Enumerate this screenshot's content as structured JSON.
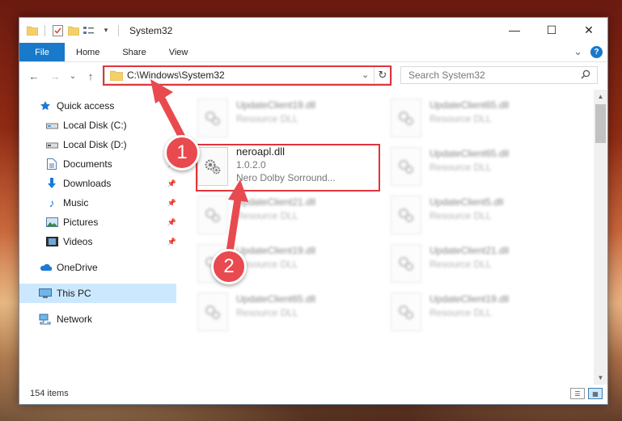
{
  "window": {
    "title": "System32",
    "controls": {
      "minimize": "—",
      "maximize": "☐",
      "close": "✕"
    }
  },
  "ribbon": {
    "tabs": [
      "File",
      "Home",
      "Share",
      "View"
    ],
    "expand_glyph": "⌄",
    "help": "?"
  },
  "address_bar": {
    "path": "C:\\Windows\\System32",
    "dropdown": "⌄",
    "refresh": "↻"
  },
  "search": {
    "placeholder": "Search System32",
    "icon": "search-icon"
  },
  "nav": {
    "back": "←",
    "forward": "→",
    "recent": "⌄",
    "up": "↑"
  },
  "sidebar": {
    "items": [
      {
        "label": "Quick access",
        "icon": "star-icon",
        "pinned": false
      },
      {
        "label": "Local Disk (C:)",
        "icon": "drive-icon",
        "pinned": false
      },
      {
        "label": "Local Disk (D:)",
        "icon": "drive-icon",
        "pinned": false
      },
      {
        "label": "Documents",
        "icon": "documents-icon",
        "pinned": true
      },
      {
        "label": "Downloads",
        "icon": "download-icon",
        "pinned": true
      },
      {
        "label": "Music",
        "icon": "music-icon",
        "pinned": true
      },
      {
        "label": "Pictures",
        "icon": "pictures-icon",
        "pinned": true
      },
      {
        "label": "Videos",
        "icon": "videos-icon",
        "pinned": true
      },
      {
        "label": "OneDrive",
        "icon": "cloud-icon",
        "pinned": false
      },
      {
        "label": "This PC",
        "icon": "pc-icon",
        "pinned": false,
        "selected": true
      },
      {
        "label": "Network",
        "icon": "network-icon",
        "pinned": false
      }
    ]
  },
  "files": {
    "left_column": [
      {
        "name": "UpdateClient19.dll",
        "sub": "Resource DLL",
        "blurred": true
      },
      {
        "name": "neroapl.dll",
        "sub": "1.0.2.0",
        "sub2": "Nero Dolby Sorround...",
        "blurred": false
      },
      {
        "name": "UpdateClient21.dll",
        "sub": "Resource DLL",
        "blurred": true
      },
      {
        "name": "UpdateClient19.dll",
        "sub": "Resource DLL",
        "blurred": true
      },
      {
        "name": "UpdateClient65.dll",
        "sub": "Resource DLL",
        "blurred": true
      }
    ],
    "right_column": [
      {
        "name": "UpdateClient65.dll",
        "sub": "Resource DLL"
      },
      {
        "name": "UpdateClient65.dll",
        "sub": "Resource DLL"
      },
      {
        "name": "UpdateClient5.dll",
        "sub": "Resource DLL"
      },
      {
        "name": "UpdateClient21.dll",
        "sub": "Resource DLL"
      },
      {
        "name": "UpdateClient19.dll",
        "sub": "Resource DLL"
      }
    ]
  },
  "status": {
    "item_count": "154 items"
  },
  "annotations": {
    "step1": "1",
    "step2": "2",
    "highlight_color": "#e0353b"
  }
}
